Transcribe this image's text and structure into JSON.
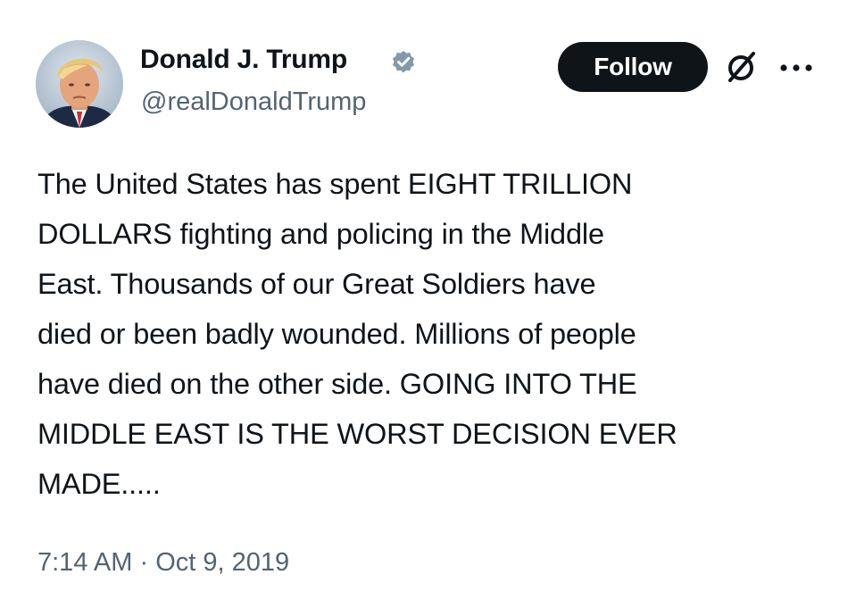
{
  "author": {
    "name": "Donald J. Trump",
    "handle": "@realDonaldTrump",
    "verified": true,
    "avatar_icon": "profile-photo"
  },
  "actions": {
    "follow_label": "Follow",
    "grok_icon": "grok-icon",
    "more_icon": "more-options-icon"
  },
  "tweet": {
    "lines": [
      "The United States has spent EIGHT TRILLION",
      "DOLLARS fighting and policing in the Middle",
      "East. Thousands of our Great Soldiers have",
      "died or been badly wounded. Millions of people",
      "have died on the other side. GOING INTO THE",
      "MIDDLE EAST IS THE WORST DECISION EVER",
      "MADE....."
    ]
  },
  "meta": {
    "time": "7:14 AM",
    "separator": "·",
    "date": "Oct 9, 2019"
  },
  "colors": {
    "text": "#0f1419",
    "secondary": "#536471",
    "verified_badge": "#829aab",
    "follow_bg": "#0f1419"
  }
}
